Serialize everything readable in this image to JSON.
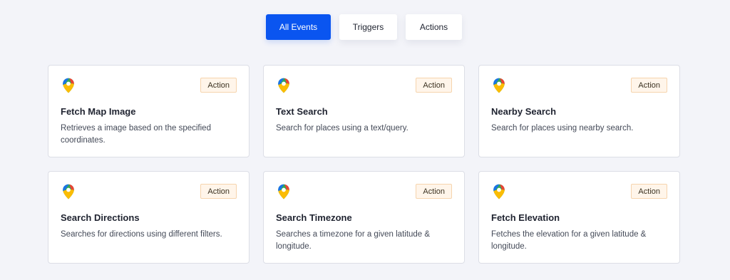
{
  "filters": [
    {
      "label": "All Events",
      "active": true
    },
    {
      "label": "Triggers",
      "active": false
    },
    {
      "label": "Actions",
      "active": false
    }
  ],
  "cards": [
    {
      "icon": "google-maps-pin-icon",
      "badge": "Action",
      "title": "Fetch Map Image",
      "description": "Retrieves a image based on the specified coordinates."
    },
    {
      "icon": "google-maps-pin-icon",
      "badge": "Action",
      "title": "Text Search",
      "description": "Search for places using a text/query."
    },
    {
      "icon": "google-maps-pin-icon",
      "badge": "Action",
      "title": "Nearby Search",
      "description": "Search for places using nearby search."
    },
    {
      "icon": "google-maps-pin-icon",
      "badge": "Action",
      "title": "Search Directions",
      "description": "Searches for directions using different filters."
    },
    {
      "icon": "google-maps-pin-icon",
      "badge": "Action",
      "title": "Search Timezone",
      "description": "Searches a timezone for a given latitude & longitude."
    },
    {
      "icon": "google-maps-pin-icon",
      "badge": "Action",
      "title": "Fetch Elevation",
      "description": "Fetches the elevation for a given latitude & longitude."
    }
  ],
  "colors": {
    "page_background": "#f3f4f9",
    "primary": "#0a55f0",
    "badge_background": "#fff5ea",
    "badge_border": "#f6d4ad"
  }
}
